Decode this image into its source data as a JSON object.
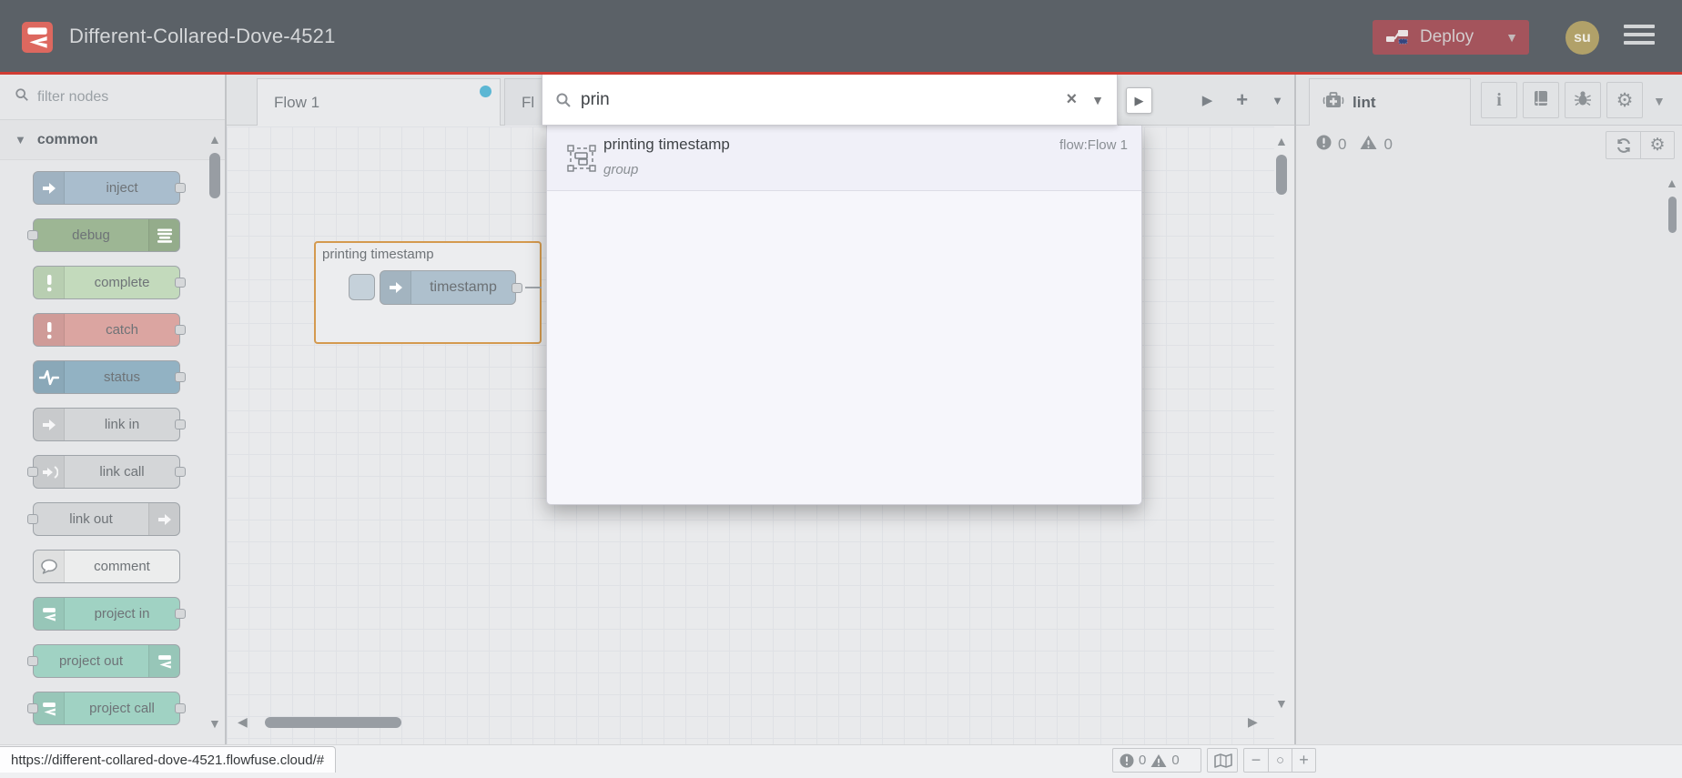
{
  "header": {
    "title": "Different-Collared-Dove-4521",
    "deploy": {
      "label": "Deploy"
    },
    "avatar": {
      "initials": "su"
    }
  },
  "palette": {
    "filter_placeholder": "filter nodes",
    "category_label": "common",
    "nodes": [
      {
        "label": "inject"
      },
      {
        "label": "debug"
      },
      {
        "label": "complete"
      },
      {
        "label": "catch"
      },
      {
        "label": "status"
      },
      {
        "label": "link in"
      },
      {
        "label": "link call"
      },
      {
        "label": "link out"
      },
      {
        "label": "comment"
      },
      {
        "label": "project in"
      },
      {
        "label": "project out"
      },
      {
        "label": "project call"
      }
    ]
  },
  "workspace": {
    "tabs": [
      {
        "label": "Flow 1",
        "modified": true
      },
      {
        "label": "Fl"
      }
    ],
    "group": {
      "label": "printing timestamp"
    },
    "node": {
      "label": "timestamp"
    }
  },
  "search": {
    "query": "prin",
    "results": [
      {
        "title": "printing timestamp",
        "type": "group",
        "location": "flow:Flow 1"
      }
    ]
  },
  "sidebar": {
    "tab_label": "lint",
    "errors": "0",
    "warnings": "0"
  },
  "canvas_footer": {
    "errors": "0",
    "warnings": "0"
  },
  "status_bar": {
    "url": "https://different-collared-dove-4521.flowfuse.cloud/#"
  },
  "colors": {
    "header_bg": "#5b6167",
    "header_accent_line": "#d03c33",
    "deploy_button_bg": "#a4545c",
    "logo_bg": "#dd685f",
    "avatar_bg": "#b1a169",
    "group_border": "#d49a4f",
    "tab_modified_dot": "#5cb7d4",
    "node_inject": "#a9bdcd",
    "node_debug": "#9db694",
    "node_complete": "#c3dabc",
    "node_catch": "#dba5a1",
    "node_status": "#92b2c3",
    "node_link": "#d4d6d8",
    "node_comment": "#eceded",
    "node_project": "#a0d2c3"
  }
}
